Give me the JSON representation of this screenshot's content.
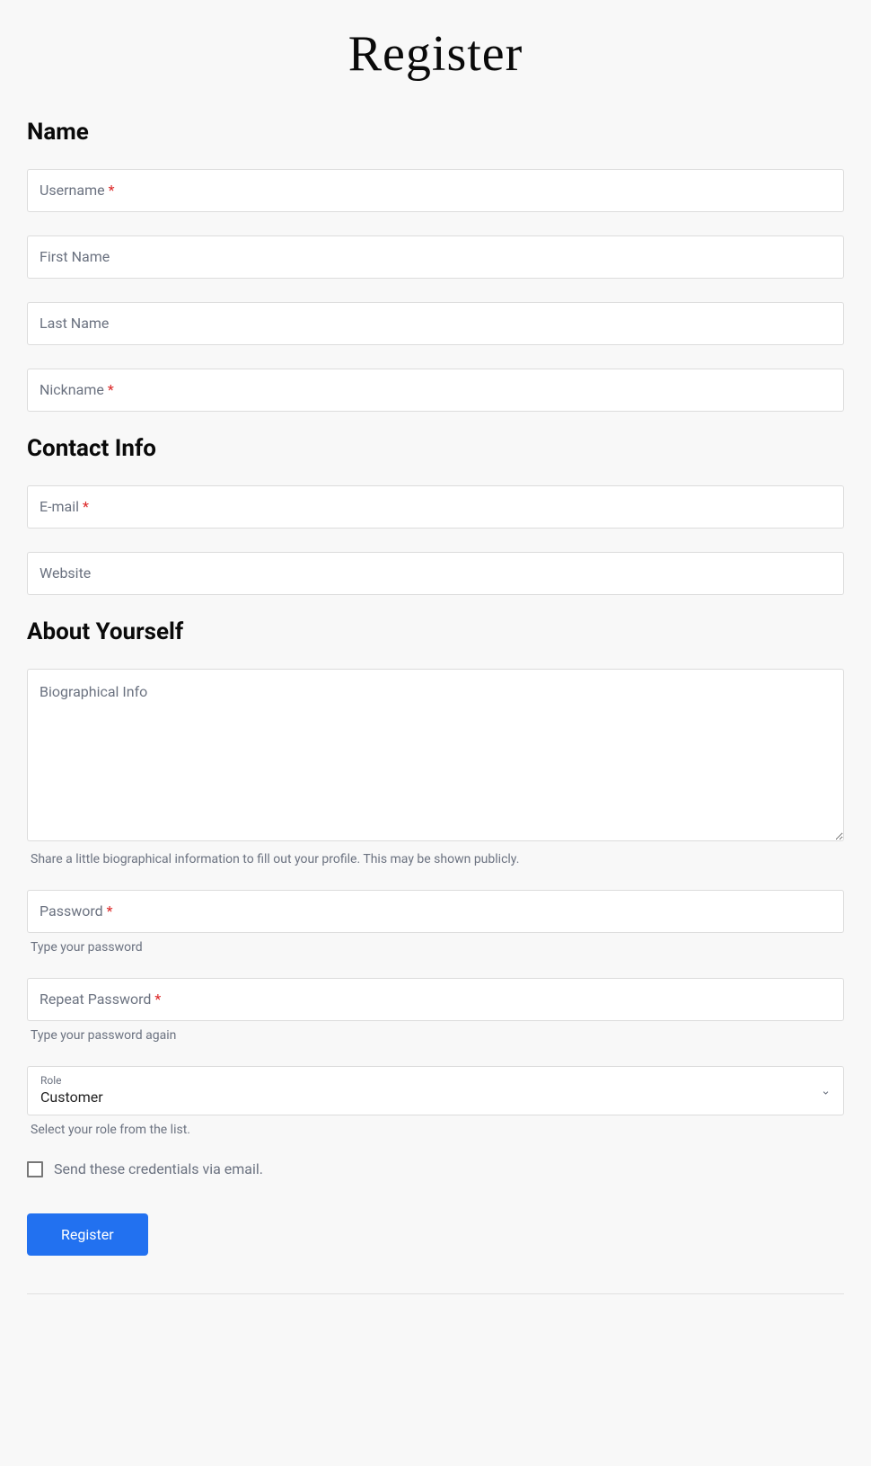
{
  "page": {
    "title": "Register"
  },
  "sections": {
    "name": {
      "heading": "Name",
      "fields": {
        "username": {
          "label": "Username",
          "required": true
        },
        "first_name": {
          "label": "First Name",
          "required": false
        },
        "last_name": {
          "label": "Last Name",
          "required": false
        },
        "nickname": {
          "label": "Nickname",
          "required": true
        }
      }
    },
    "contact": {
      "heading": "Contact Info",
      "fields": {
        "email": {
          "label": "E-mail",
          "required": true
        },
        "website": {
          "label": "Website",
          "required": false
        }
      }
    },
    "about": {
      "heading": "About Yourself",
      "fields": {
        "bio": {
          "label": "Biographical Info",
          "help": "Share a little biographical information to fill out your profile. This may be shown publicly."
        },
        "password": {
          "label": "Password",
          "required": true,
          "help": "Type your password"
        },
        "repeat_password": {
          "label": "Repeat Password",
          "required": true,
          "help": "Type your password again"
        },
        "role": {
          "label": "Role",
          "value": "Customer",
          "help": "Select your role from the list."
        },
        "send_email": {
          "label": "Send these credentials via email.",
          "checked": false
        }
      }
    }
  },
  "submit": {
    "label": "Register"
  },
  "required_marker": "*"
}
